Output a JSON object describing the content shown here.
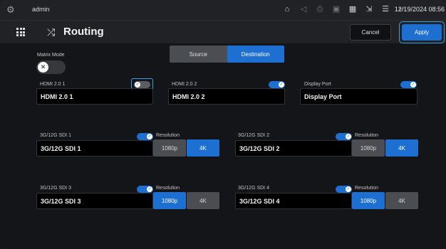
{
  "statusbar": {
    "user": "admin",
    "datetime": "12/19/2024 08:56",
    "icons": [
      "home-icon",
      "volume-icon",
      "printer-icon",
      "record-icon",
      "qr-icon",
      "share-screen-icon",
      "server-icon",
      "usb-icon"
    ]
  },
  "titlebar": {
    "title": "Routing",
    "cancel_label": "Cancel",
    "apply_label": "Apply"
  },
  "matrix_mode": {
    "label": "Matrix Mode",
    "enabled": false
  },
  "tabs": [
    {
      "label": "Source",
      "active": false
    },
    {
      "label": "Destination",
      "active": true
    }
  ],
  "hdmi": [
    {
      "label": "HDMI 2.0 1",
      "value": "HDMI 2.0 1",
      "enabled": false
    },
    {
      "label": "HDMI 2.0 2",
      "value": "HDMI 2.0 2",
      "enabled": true
    },
    {
      "label": "Display Port",
      "value": "Display Port",
      "enabled": true
    }
  ],
  "resolution_label": "Resolution",
  "sdi": [
    {
      "label": "3G/12G SDI 1",
      "value": "3G/12G SDI 1",
      "enabled": true,
      "res_1080p": "1080p",
      "res_4k": "4K",
      "selected": "4K"
    },
    {
      "label": "3G/12G SDI 2",
      "value": "3G/12G SDI 2",
      "enabled": true,
      "res_1080p": "1080p",
      "res_4k": "4K",
      "selected": "4K"
    },
    {
      "label": "3G/12G SDI 3",
      "value": "3G/12G SDI 3",
      "enabled": true,
      "res_1080p": "1080p",
      "res_4k": "4K",
      "selected": "1080p"
    },
    {
      "label": "3G/12G SDI 4",
      "value": "3G/12G SDI 4",
      "enabled": true,
      "res_1080p": "1080p",
      "res_4k": "4K",
      "selected": "1080p"
    }
  ],
  "colors": {
    "accent": "#1e6fd2",
    "focus": "#35a3e8",
    "background": "#141518"
  }
}
